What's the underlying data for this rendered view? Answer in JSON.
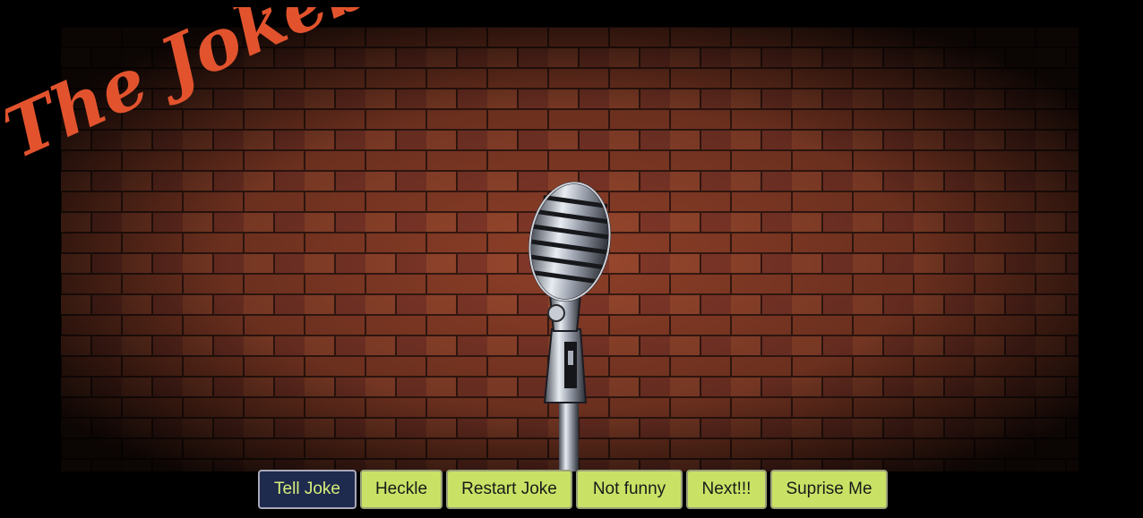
{
  "app": {
    "title": "The Jokebox",
    "accent_color": "#e2532d"
  },
  "stage": {
    "background": "brick-wall",
    "prop_icon": "microphone-icon"
  },
  "toolbar": {
    "buttons": [
      {
        "label": "Tell Joke",
        "active": true
      },
      {
        "label": "Heckle",
        "active": false
      },
      {
        "label": "Restart Joke",
        "active": false
      },
      {
        "label": "Not funny",
        "active": false
      },
      {
        "label": "Next!!!",
        "active": false
      },
      {
        "label": "Suprise Me",
        "active": false
      }
    ],
    "active_color": "#1e2a4e",
    "button_color": "#c9e265"
  }
}
